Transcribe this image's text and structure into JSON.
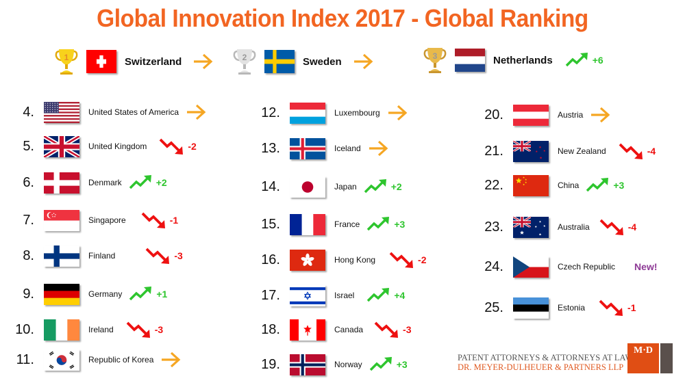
{
  "title": "Global Innovation Index 2017 - Global Ranking",
  "colors": {
    "accent": "#f26522",
    "up": "#2ec52e",
    "down": "#ee1111",
    "same": "#f5a623",
    "new": "#8e3a96"
  },
  "podium": [
    {
      "rank": 1,
      "trophy": "gold-trophy-icon",
      "country": "Switzerland",
      "flag": "switzerland",
      "trend": "same",
      "delta": ""
    },
    {
      "rank": 2,
      "trophy": "silver-trophy-icon",
      "country": "Sweden",
      "flag": "sweden",
      "trend": "same",
      "delta": ""
    },
    {
      "rank": 3,
      "trophy": "bronze-trophy-icon",
      "country": "Netherlands",
      "flag": "netherlands",
      "trend": "up",
      "delta": "+6"
    }
  ],
  "columns": [
    [
      {
        "rank": "4.",
        "country": "United States of America",
        "flag": "usa",
        "trend": "same",
        "delta": ""
      },
      {
        "rank": "5.",
        "country": "United Kingdom",
        "flag": "uk",
        "trend": "down",
        "delta": "-2"
      },
      {
        "rank": "6.",
        "country": "Denmark",
        "flag": "denmark",
        "trend": "up",
        "delta": "+2"
      },
      {
        "rank": "7.",
        "country": "Singapore",
        "flag": "singapore",
        "trend": "down",
        "delta": "-1"
      },
      {
        "rank": "8.",
        "country": "Finland",
        "flag": "finland",
        "trend": "down",
        "delta": "-3"
      },
      {
        "rank": "9.",
        "country": "Germany",
        "flag": "germany",
        "trend": "up",
        "delta": "+1"
      },
      {
        "rank": "10.",
        "country": "Ireland",
        "flag": "ireland",
        "trend": "down",
        "delta": "-3"
      },
      {
        "rank": "11.",
        "country": "Republic of Korea",
        "flag": "korea",
        "trend": "same",
        "delta": ""
      }
    ],
    [
      {
        "rank": "12.",
        "country": "Luxembourg",
        "flag": "luxembourg",
        "trend": "same",
        "delta": ""
      },
      {
        "rank": "13.",
        "country": "Iceland",
        "flag": "iceland",
        "trend": "same",
        "delta": ""
      },
      {
        "rank": "14.",
        "country": "Japan",
        "flag": "japan",
        "trend": "up",
        "delta": "+2"
      },
      {
        "rank": "15.",
        "country": "France",
        "flag": "france",
        "trend": "up",
        "delta": "+3"
      },
      {
        "rank": "16.",
        "country": "Hong Kong",
        "flag": "hongkong",
        "trend": "down",
        "delta": "-2"
      },
      {
        "rank": "17.",
        "country": "Israel",
        "flag": "israel",
        "trend": "up",
        "delta": "+4"
      },
      {
        "rank": "18.",
        "country": "Canada",
        "flag": "canada",
        "trend": "down",
        "delta": "-3"
      },
      {
        "rank": "19.",
        "country": "Norway",
        "flag": "norway",
        "trend": "up",
        "delta": "+3"
      }
    ],
    [
      {
        "rank": "20.",
        "country": "Austria",
        "flag": "austria",
        "trend": "same",
        "delta": ""
      },
      {
        "rank": "21.",
        "country": "New Zealand",
        "flag": "newzealand",
        "trend": "down",
        "delta": "-4"
      },
      {
        "rank": "22.",
        "country": "China",
        "flag": "china",
        "trend": "up",
        "delta": "+3"
      },
      {
        "rank": "23.",
        "country": "Australia",
        "flag": "australia",
        "trend": "down",
        "delta": "-4"
      },
      {
        "rank": "24.",
        "country": "Czech Republic",
        "flag": "czech",
        "trend": "new",
        "delta": "New!"
      },
      {
        "rank": "25.",
        "country": "Estonia",
        "flag": "estonia",
        "trend": "down",
        "delta": "-1"
      }
    ]
  ],
  "footer": {
    "line1": "PATENT ATTORNEYS & ATTORNEYS AT LAW",
    "line2": "DR. MEYER-DULHEUER & PARTNERS LLP",
    "logo_text": "M·D"
  }
}
